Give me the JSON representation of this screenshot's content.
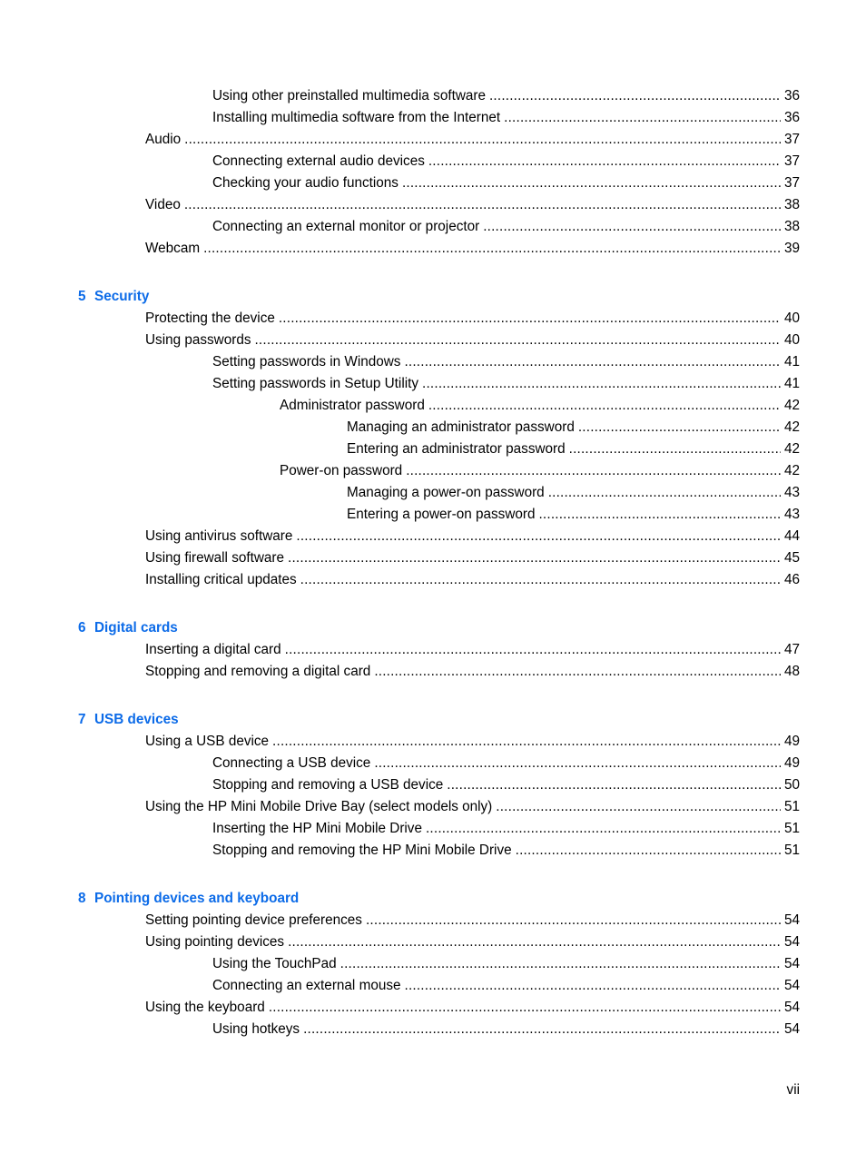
{
  "toc": {
    "pre_entries": [
      {
        "level": 2,
        "title": "Using other preinstalled multimedia software",
        "page": "36"
      },
      {
        "level": 2,
        "title": "Installing multimedia software from the Internet",
        "page": "36"
      },
      {
        "level": 1,
        "title": "Audio",
        "page": "37"
      },
      {
        "level": 2,
        "title": "Connecting external audio devices",
        "page": "37"
      },
      {
        "level": 2,
        "title": "Checking your audio functions",
        "page": "37"
      },
      {
        "level": 1,
        "title": "Video",
        "page": "38"
      },
      {
        "level": 2,
        "title": "Connecting an external monitor or projector",
        "page": "38"
      },
      {
        "level": 1,
        "title": "Webcam",
        "page": "39"
      }
    ],
    "chapters": [
      {
        "number": "5",
        "title": "Security",
        "entries": [
          {
            "level": 1,
            "title": "Protecting the device",
            "page": "40"
          },
          {
            "level": 1,
            "title": "Using passwords",
            "page": "40"
          },
          {
            "level": 2,
            "title": "Setting passwords in Windows",
            "page": "41"
          },
          {
            "level": 2,
            "title": "Setting passwords in Setup Utility",
            "page": "41"
          },
          {
            "level": 3,
            "title": "Administrator password",
            "page": "42"
          },
          {
            "level": 4,
            "title": "Managing an administrator password",
            "page": "42"
          },
          {
            "level": 4,
            "title": "Entering an administrator password",
            "page": "42"
          },
          {
            "level": 3,
            "title": "Power-on password",
            "page": "42"
          },
          {
            "level": 4,
            "title": "Managing a power-on password",
            "page": "43"
          },
          {
            "level": 4,
            "title": "Entering a power-on password",
            "page": "43"
          },
          {
            "level": 1,
            "title": "Using antivirus software",
            "page": "44"
          },
          {
            "level": 1,
            "title": "Using firewall software",
            "page": "45"
          },
          {
            "level": 1,
            "title": "Installing critical updates",
            "page": "46"
          }
        ]
      },
      {
        "number": "6",
        "title": "Digital cards",
        "entries": [
          {
            "level": 1,
            "title": "Inserting a digital card",
            "page": "47"
          },
          {
            "level": 1,
            "title": "Stopping and removing a digital card",
            "page": "48"
          }
        ]
      },
      {
        "number": "7",
        "title": "USB devices",
        "entries": [
          {
            "level": 1,
            "title": "Using a USB device",
            "page": "49"
          },
          {
            "level": 2,
            "title": "Connecting a USB device",
            "page": "49"
          },
          {
            "level": 2,
            "title": "Stopping and removing a USB device",
            "page": "50"
          },
          {
            "level": 1,
            "title": "Using the HP Mini Mobile Drive Bay (select models only)",
            "page": "51"
          },
          {
            "level": 2,
            "title": "Inserting the HP Mini Mobile Drive",
            "page": "51"
          },
          {
            "level": 2,
            "title": "Stopping and removing the HP Mini Mobile Drive",
            "page": "51"
          }
        ]
      },
      {
        "number": "8",
        "title": "Pointing devices and keyboard",
        "entries": [
          {
            "level": 1,
            "title": "Setting pointing device preferences",
            "page": "54"
          },
          {
            "level": 1,
            "title": "Using pointing devices",
            "page": "54"
          },
          {
            "level": 2,
            "title": "Using the TouchPad",
            "page": "54"
          },
          {
            "level": 2,
            "title": "Connecting an external mouse",
            "page": "54"
          },
          {
            "level": 1,
            "title": "Using the keyboard",
            "page": "54"
          },
          {
            "level": 2,
            "title": "Using hotkeys",
            "page": "54"
          }
        ]
      }
    ]
  },
  "footer": {
    "page_number": "vii"
  },
  "colors": {
    "chapter_heading": "#0c6be8",
    "text": "#000000"
  }
}
